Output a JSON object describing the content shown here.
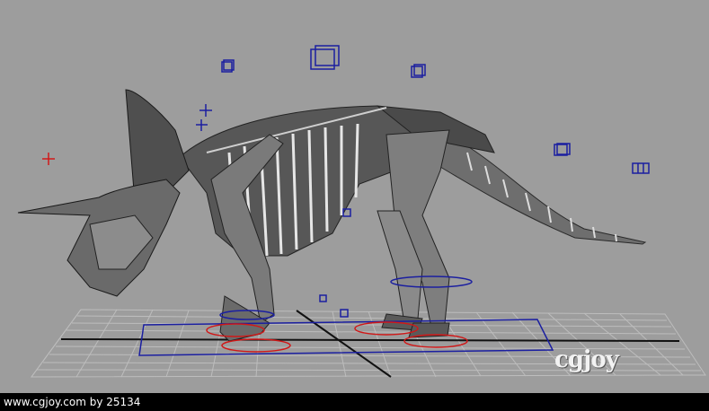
{
  "viewport": {
    "background": "#9d9d9d",
    "grid_color": "#bdbdbd",
    "axis_color": "#111111",
    "control_color_blue": "#1b1fa0",
    "control_color_red": "#d01818",
    "icons": [
      "locator-cross-icon",
      "cube-control-icon",
      "foot-ring-control-icon"
    ]
  },
  "watermark": {
    "text": "cgjoy"
  },
  "footer": {
    "credit": "www.cgjoy.com by 25134"
  }
}
